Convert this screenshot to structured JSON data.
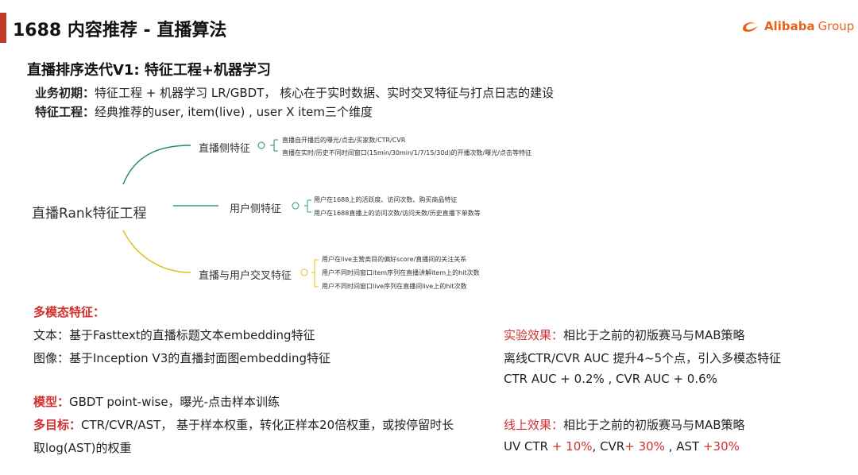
{
  "header": {
    "title": "1688 内容推荐 - 直播算法",
    "logo_text": "Alibaba",
    "logo_sub": "Group"
  },
  "section_title": "直播排序迭代V1: 特征工程+机器学习",
  "intro": {
    "line1_label": "业务初期：",
    "line1_text": "特征工程 + 机器学习 LR/GBDT， 核心在于实时数据、实时交叉特征与打点日志的建设",
    "line2_label": "特征工程：",
    "line2_text": "经典推荐的user, item(live) , user X item三个维度"
  },
  "mindmap": {
    "center": "直播Rank特征工程",
    "branches": [
      {
        "label": "直播侧特征",
        "leaves": [
          "直播自开播后的曝光/点击/买家数/CTR/CVR",
          "直播在实时/历史不同时间窗口(15min/30min/1/7/15/30d)的开播次数/曝光/点击等特征"
        ]
      },
      {
        "label": "用户侧特征",
        "leaves": [
          "用户在1688上的活跃度、访问次数、购买商品特征",
          "用户在1688直播上的访问次数/访问天数/历史直播下单数等"
        ]
      },
      {
        "label": "直播与用户交叉特征",
        "leaves": [
          "用户在live主营类目的偏好score/直播间的关注关系",
          "用户不同时间窗口item序列在直播讲解item上的hit次数",
          "用户不同时间窗口live序列在直播间live上的hit次数"
        ]
      }
    ]
  },
  "multimodal": {
    "title": "多模态特征：",
    "text_line": "文本：基于Fasttext的直播标题文本embedding特征",
    "image_line": "图像：基于Inception V3的直播封面图embedding特征"
  },
  "model": {
    "label": "模型：",
    "text": "GBDT point-wise，曝光-点击样本训练"
  },
  "multi_target": {
    "label": "多目标：",
    "text1": "CTR/CVR/AST， 基于样本权重，转化正样本20倍权重，或按停留时长",
    "text2": "取log(AST)的权重"
  },
  "experiment": {
    "label": "实验效果：",
    "text": "相比于之前的初版赛马与MAB策略",
    "line2": "离线CTR/CVR AUC 提升4~5个点，引入多模态特征",
    "line3": "CTR AUC + 0.2% , CVR AUC + 0.6%"
  },
  "online": {
    "label": "线上效果：",
    "text": "相比于之前的初版赛马与MAB策略",
    "uv_ctr": "UV CTR",
    "uv_ctr_val": " + 10%",
    "cvr": ", CVR",
    "cvr_val": "+ 30%",
    "ast": " ,  AST ",
    "ast_val": "+30%"
  },
  "colors": {
    "accent_red": "#c0392b",
    "highlight_red": "#d32f2f",
    "alibaba_orange": "#e8621a",
    "branch1": "#1f8a7a",
    "branch2": "#2a9d8f",
    "branch3": "#e0c020"
  }
}
